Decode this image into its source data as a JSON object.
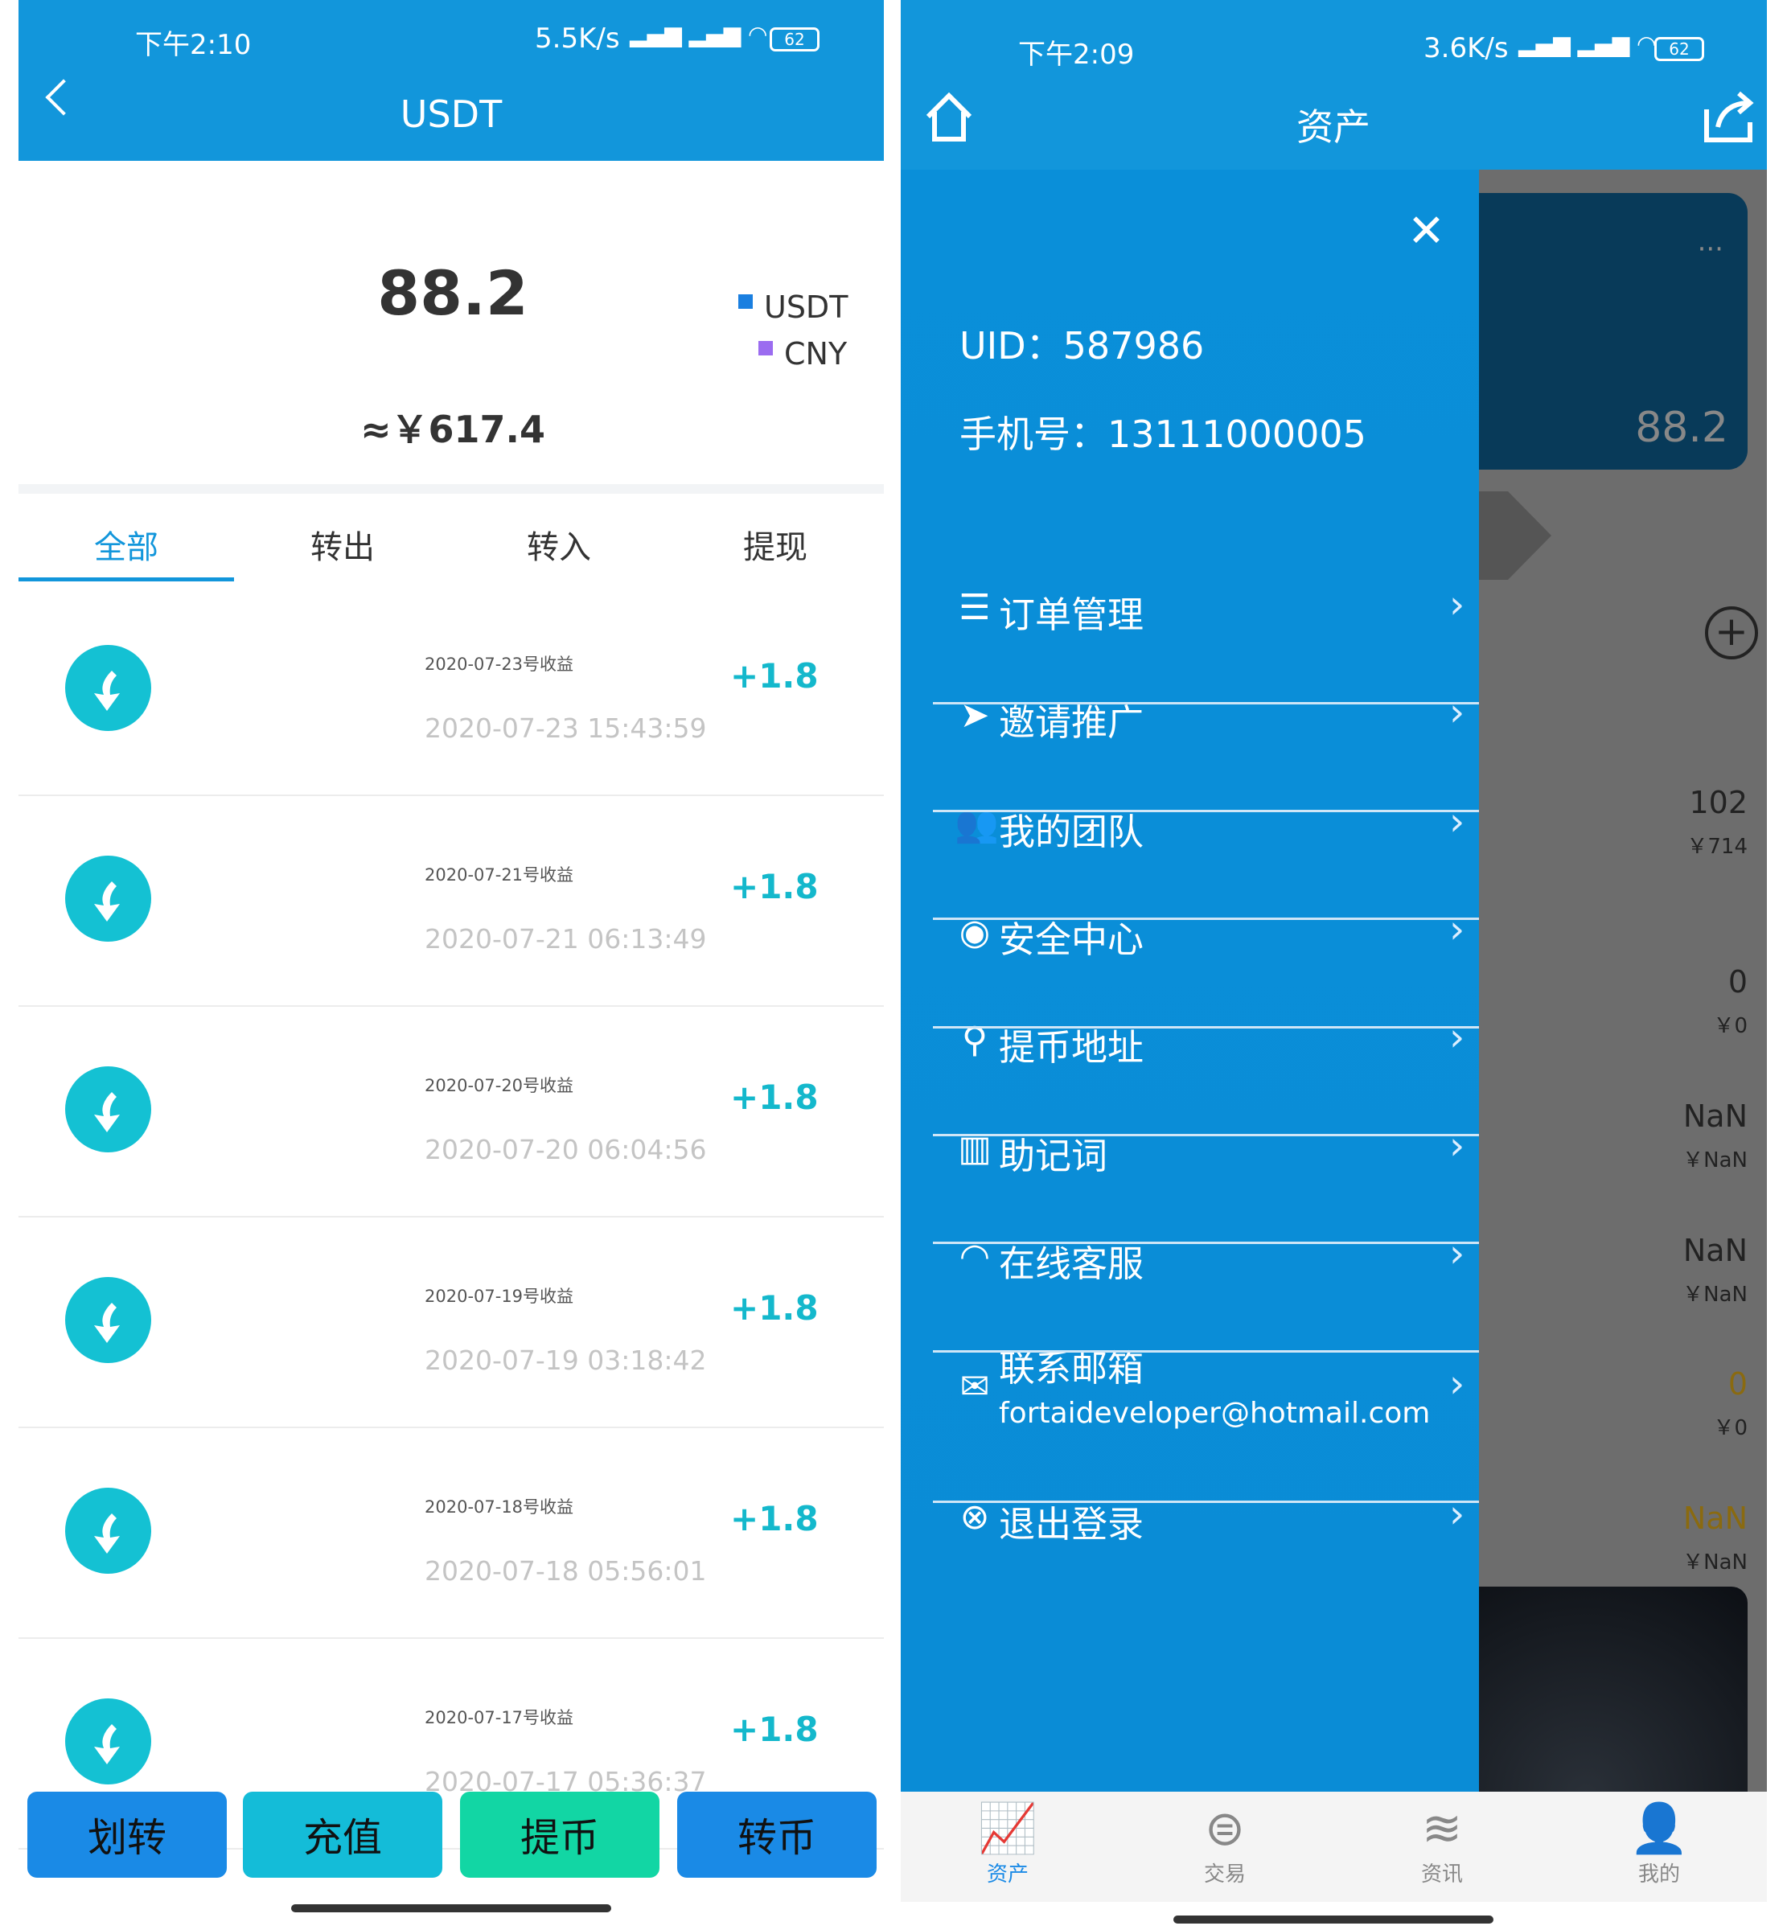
{
  "left": {
    "status": {
      "time": "下午2:10",
      "speed": "5.5K/s",
      "battery": "62"
    },
    "title": "USDT",
    "balance": "88.2",
    "cny_equiv": "≈￥617.4",
    "legend": [
      {
        "label": "USDT",
        "color": "#1a7fe0"
      },
      {
        "label": "CNY",
        "color": "#9b6cf0"
      }
    ],
    "tabs": [
      {
        "label": "全部",
        "active": true
      },
      {
        "label": "转出"
      },
      {
        "label": "转入"
      },
      {
        "label": "提现"
      }
    ],
    "accent": "#1296db",
    "records": [
      {
        "title": "2020-07-23号收益",
        "time": "2020-07-23 15:43:59",
        "amount": "+1.8"
      },
      {
        "title": "2020-07-21号收益",
        "time": "2020-07-21 06:13:49",
        "amount": "+1.8"
      },
      {
        "title": "2020-07-20号收益",
        "time": "2020-07-20 06:04:56",
        "amount": "+1.8"
      },
      {
        "title": "2020-07-19号收益",
        "time": "2020-07-19 03:18:42",
        "amount": "+1.8"
      },
      {
        "title": "2020-07-18号收益",
        "time": "2020-07-18 05:56:01",
        "amount": "+1.8"
      },
      {
        "title": "2020-07-17号收益",
        "time": "2020-07-17 05:36:37",
        "amount": "+1.8"
      }
    ],
    "buttons": [
      {
        "label": "划转",
        "color": "#1a8ae6"
      },
      {
        "label": "充值",
        "color": "#14bcd8"
      },
      {
        "label": "提币",
        "color": "#12d6a4"
      },
      {
        "label": "转币",
        "color": "#1a8ae6"
      }
    ]
  },
  "right": {
    "status": {
      "time": "下午2:09",
      "speed": "3.6K/s",
      "battery": "62"
    },
    "title": "资产",
    "drawer": {
      "uid": "UID：587986",
      "phone": "手机号：13111000005",
      "menu": [
        {
          "label": "订单管理",
          "icon": "list-icon"
        },
        {
          "label": "邀请推广",
          "icon": "send-icon"
        },
        {
          "label": "我的团队",
          "icon": "team-icon"
        },
        {
          "label": "安全中心",
          "icon": "user-circle-icon"
        },
        {
          "label": "提币地址",
          "icon": "location-icon"
        },
        {
          "label": "助记词",
          "icon": "map-icon"
        },
        {
          "label": "在线客服",
          "icon": "headset-icon"
        },
        {
          "label": "联系邮箱",
          "sub": "fortaideveloper@hotmail.com",
          "icon": "mail-icon"
        },
        {
          "label": "退出登录",
          "icon": "logout-icon"
        }
      ]
    },
    "background": {
      "card_value": "88.2",
      "assets": [
        {
          "value": "102",
          "cny": "￥714"
        },
        {
          "value": "0",
          "cny": "￥0"
        },
        {
          "value": "NaN",
          "cny": "￥NaN"
        },
        {
          "value": "NaN",
          "cny": "￥NaN"
        },
        {
          "value": "0",
          "cny": "￥0",
          "highlight": true
        },
        {
          "value": "NaN",
          "cny": "￥NaN",
          "highlight": true
        }
      ]
    },
    "nav": [
      {
        "label": "资产",
        "icon": "chart-icon",
        "active": true
      },
      {
        "label": "交易",
        "icon": "exchange-icon"
      },
      {
        "label": "资讯",
        "icon": "layers-icon"
      },
      {
        "label": "我的",
        "icon": "person-icon"
      }
    ]
  }
}
